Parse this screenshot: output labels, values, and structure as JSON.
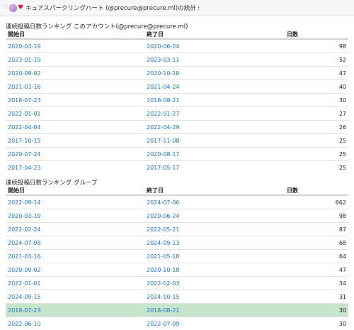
{
  "header": {
    "title": "キュアスパークリングハート (@precure@precure.ml)の統計 ⁝"
  },
  "account_table": {
    "title": "連続投稿日数ランキング このアカウント(@precure@precure.ml)",
    "columns": [
      "開始日",
      "終了日",
      "日数"
    ],
    "rows": [
      [
        "2020-03-19",
        "2020-06-24",
        "98"
      ],
      [
        "2023-01-19",
        "2023-03-11",
        "52"
      ],
      [
        "2020-09-02",
        "2020-10-18",
        "47"
      ],
      [
        "2021-03-16",
        "2021-04-24",
        "40"
      ],
      [
        "2018-07-23",
        "2018-08-21",
        "30"
      ],
      [
        "2022-01-01",
        "2022-01-27",
        "27"
      ],
      [
        "2022-04-04",
        "2022-04-29",
        "26"
      ],
      [
        "2017-10-15",
        "2017-11-08",
        "25"
      ],
      [
        "2020-07-24",
        "2020-08-17",
        "25"
      ],
      [
        "2017-04-23",
        "2017-05-17",
        "25"
      ]
    ]
  },
  "group_table": {
    "title": "連続投稿日数ランキング グループ",
    "columns": [
      "開始日",
      "終了日",
      "日数"
    ],
    "highlight_row": 8,
    "highlight_color": "#c7e5cc",
    "rows": [
      [
        "2022-09-14",
        "2024-07-06",
        "662"
      ],
      [
        "2020-03-19",
        "2020-06-24",
        "98"
      ],
      [
        "2022-02-24",
        "2022-05-21",
        "87"
      ],
      [
        "2024-07-08",
        "2024-09-13",
        "68"
      ],
      [
        "2021-03-16",
        "2021-05-18",
        "64"
      ],
      [
        "2020-09-02",
        "2020-10-18",
        "47"
      ],
      [
        "2022-01-01",
        "2022-02-03",
        "34"
      ],
      [
        "2024-09-15",
        "2024-10-15",
        "31"
      ],
      [
        "2018-07-23",
        "2018-08-21",
        "30"
      ],
      [
        "2022-06-10",
        "2022-07-09",
        "30"
      ]
    ]
  },
  "colors": {
    "link": "#1a73c8",
    "header_bg": "#f5f6f7"
  }
}
